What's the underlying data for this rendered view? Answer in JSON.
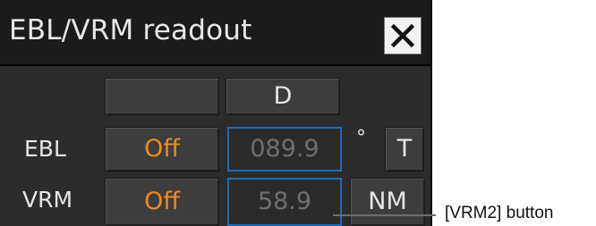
{
  "window": {
    "title": "EBL/VRM readout",
    "close_icon": "close-icon"
  },
  "header_row": {
    "left_label": "",
    "right_label": "D"
  },
  "ebl": {
    "row_label": "EBL",
    "toggle_label": "Off",
    "value": "089.9",
    "unit_symbol": "°",
    "unit_button": "T"
  },
  "vrm": {
    "row_label": "VRM",
    "toggle_label": "Off",
    "value": "58.9",
    "unit_button": "NM"
  },
  "callout": {
    "text": "[VRM2] button"
  },
  "colors": {
    "accent_orange": "#f08a1c",
    "field_border_blue": "#1e6bb5",
    "panel_bg": "#2c2c2c",
    "title_bg": "#1b1b1b"
  }
}
